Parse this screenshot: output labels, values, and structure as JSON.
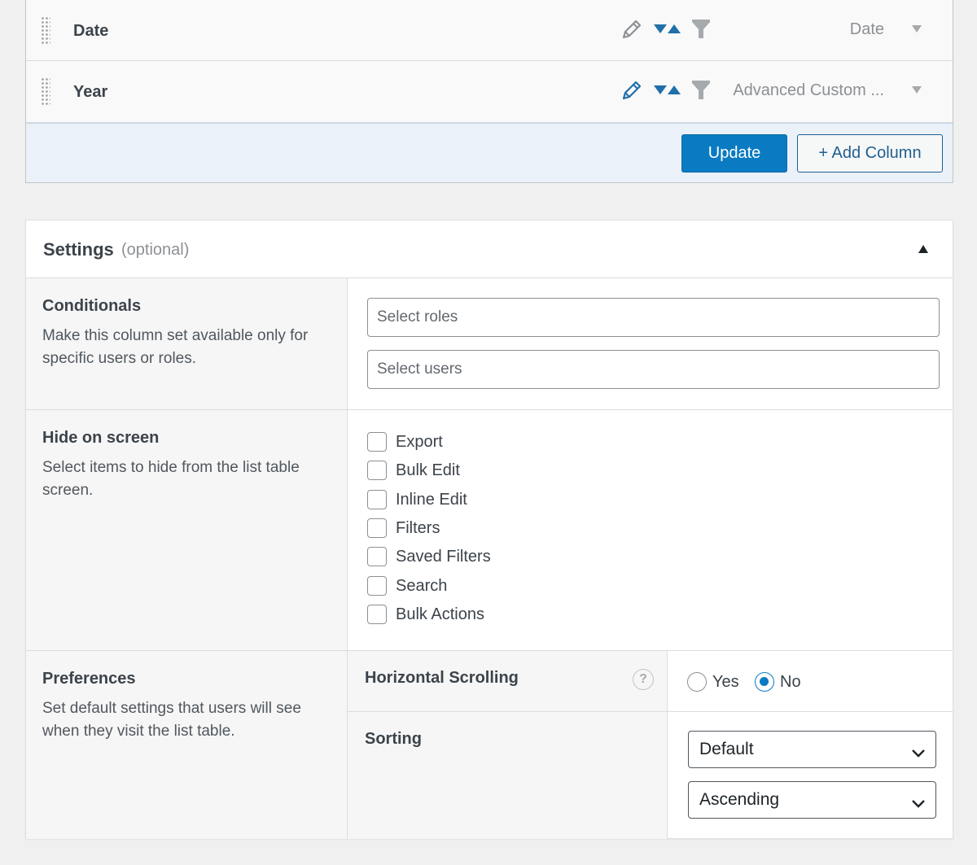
{
  "columns": {
    "rows": [
      {
        "label": "Date",
        "type": "Date",
        "edit_icon": "pencil-icon",
        "edit_color": "#8c8f94"
      },
      {
        "label": "Year",
        "type": "Advanced Custom ...",
        "edit_icon": "pencil-icon",
        "edit_color": "#1f6fa8"
      }
    ],
    "update_label": "Update",
    "add_column_label": "+ Add Column"
  },
  "settings": {
    "title": "Settings",
    "optional": "(optional)",
    "conditionals": {
      "title": "Conditionals",
      "description": "Make this column set available only for specific users or roles.",
      "roles_placeholder": "Select roles",
      "users_placeholder": "Select users"
    },
    "hide_on_screen": {
      "title": "Hide on screen",
      "description": "Select items to hide from the list table screen.",
      "items": [
        {
          "label": "Export",
          "checked": false
        },
        {
          "label": "Bulk Edit",
          "checked": false
        },
        {
          "label": "Inline Edit",
          "checked": false
        },
        {
          "label": "Filters",
          "checked": false
        },
        {
          "label": "Saved Filters",
          "checked": false
        },
        {
          "label": "Search",
          "checked": false
        },
        {
          "label": "Bulk Actions",
          "checked": false
        }
      ]
    },
    "preferences": {
      "title": "Preferences",
      "description": "Set default settings that users will see when they visit the list table.",
      "horizontal_scrolling": {
        "label": "Horizontal Scrolling",
        "help": "?",
        "options": [
          "Yes",
          "No"
        ],
        "selected": "No"
      },
      "sorting": {
        "label": "Sorting",
        "column_value": "Default",
        "order_value": "Ascending"
      }
    }
  },
  "colors": {
    "primary": "#0a7bc2",
    "footer_bg": "#eaf1f8",
    "panel_bg": "#f6f6f6",
    "sort_icon": "#1f6fa8",
    "filter_icon": "#a7aaad"
  }
}
